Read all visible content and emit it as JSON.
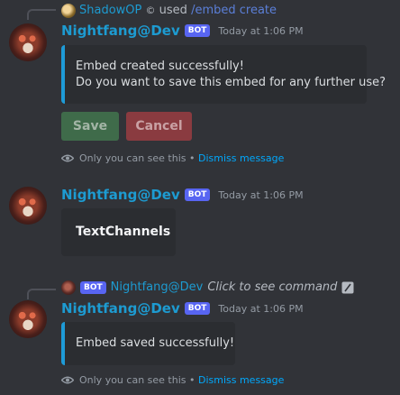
{
  "messages": [
    {
      "reply": {
        "user": "ShadowOP",
        "used": "used",
        "command": "/embed create"
      },
      "author": "Nightfang@Dev",
      "badge": "BOT",
      "time": "Today at 1:06 PM",
      "embed": {
        "line1": "Embed created successfully!",
        "line2": "Do you want to save this embed for any further use?"
      },
      "buttons": {
        "save": "Save",
        "cancel": "Cancel"
      },
      "ephemeral": {
        "notice": "Only you can see this •",
        "dismiss": "Dismiss message"
      }
    },
    {
      "author": "Nightfang@Dev",
      "badge": "BOT",
      "time": "Today at 1:06 PM",
      "embed": {
        "title": "TextChannels"
      }
    },
    {
      "reply": {
        "badge": "BOT",
        "user": "Nightfang@Dev",
        "hint": "Click to see command"
      },
      "author": "Nightfang@Dev",
      "badge": "BOT",
      "time": "Today at 1:06 PM",
      "embed": {
        "text": "Embed saved successfully!"
      },
      "ephemeral": {
        "notice": "Only you can see this •",
        "dismiss": "Dismiss message"
      }
    }
  ],
  "colors": {
    "background": "#313338",
    "embed_bg": "#2b2d31",
    "accent_bar": "#1e9bd7",
    "username": "#1d9bd1",
    "bot_badge": "#5865f2",
    "save_btn": "#3f6b4a",
    "cancel_btn": "#8a3b40",
    "link": "#00a8fc"
  }
}
